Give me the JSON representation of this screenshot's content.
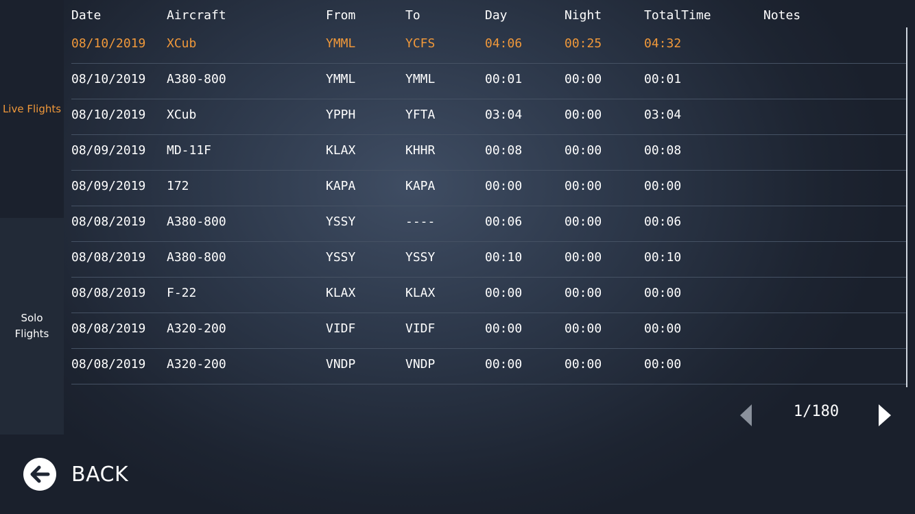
{
  "sidebar": {
    "live_label": "Live Flights",
    "solo_label": "Solo Flights"
  },
  "columns": {
    "date": "Date",
    "aircraft": "Aircraft",
    "from": "From",
    "to": "To",
    "day": "Day",
    "night": "Night",
    "total": "TotalTime",
    "notes": "Notes"
  },
  "rows": [
    {
      "date": "08/10/2019",
      "aircraft": "XCub",
      "from": "YMML",
      "to": "YCFS",
      "day": "04:06",
      "night": "00:25",
      "total": "04:32",
      "notes": ""
    },
    {
      "date": "08/10/2019",
      "aircraft": "A380-800",
      "from": "YMML",
      "to": "YMML",
      "day": "00:01",
      "night": "00:00",
      "total": "00:01",
      "notes": ""
    },
    {
      "date": "08/10/2019",
      "aircraft": "XCub",
      "from": "YPPH",
      "to": "YFTA",
      "day": "03:04",
      "night": "00:00",
      "total": "03:04",
      "notes": ""
    },
    {
      "date": "08/09/2019",
      "aircraft": "MD-11F",
      "from": "KLAX",
      "to": "KHHR",
      "day": "00:08",
      "night": "00:00",
      "total": "00:08",
      "notes": ""
    },
    {
      "date": "08/09/2019",
      "aircraft": "172",
      "from": "KAPA",
      "to": "KAPA",
      "day": "00:00",
      "night": "00:00",
      "total": "00:00",
      "notes": ""
    },
    {
      "date": "08/08/2019",
      "aircraft": "A380-800",
      "from": "YSSY",
      "to": "----",
      "day": "00:06",
      "night": "00:00",
      "total": "00:06",
      "notes": ""
    },
    {
      "date": "08/08/2019",
      "aircraft": "A380-800",
      "from": "YSSY",
      "to": "YSSY",
      "day": "00:10",
      "night": "00:00",
      "total": "00:10",
      "notes": ""
    },
    {
      "date": "08/08/2019",
      "aircraft": "F-22",
      "from": "KLAX",
      "to": "KLAX",
      "day": "00:00",
      "night": "00:00",
      "total": "00:00",
      "notes": ""
    },
    {
      "date": "08/08/2019",
      "aircraft": "A320-200",
      "from": "VIDF",
      "to": "VIDF",
      "day": "00:00",
      "night": "00:00",
      "total": "00:00",
      "notes": ""
    },
    {
      "date": "08/08/2019",
      "aircraft": "A320-200",
      "from": "VNDP",
      "to": "VNDP",
      "day": "00:00",
      "night": "00:00",
      "total": "00:00",
      "notes": ""
    }
  ],
  "pagination": {
    "indicator": "1/180",
    "prev_icon": "triangle-left-icon",
    "next_icon": "triangle-right-icon"
  },
  "back": {
    "label": "BACK",
    "icon": "arrow-left-circle-icon"
  },
  "colors": {
    "accent": "#f0983a",
    "text": "#ffffff",
    "divider": "#465264",
    "disabled": "#8a919c"
  }
}
